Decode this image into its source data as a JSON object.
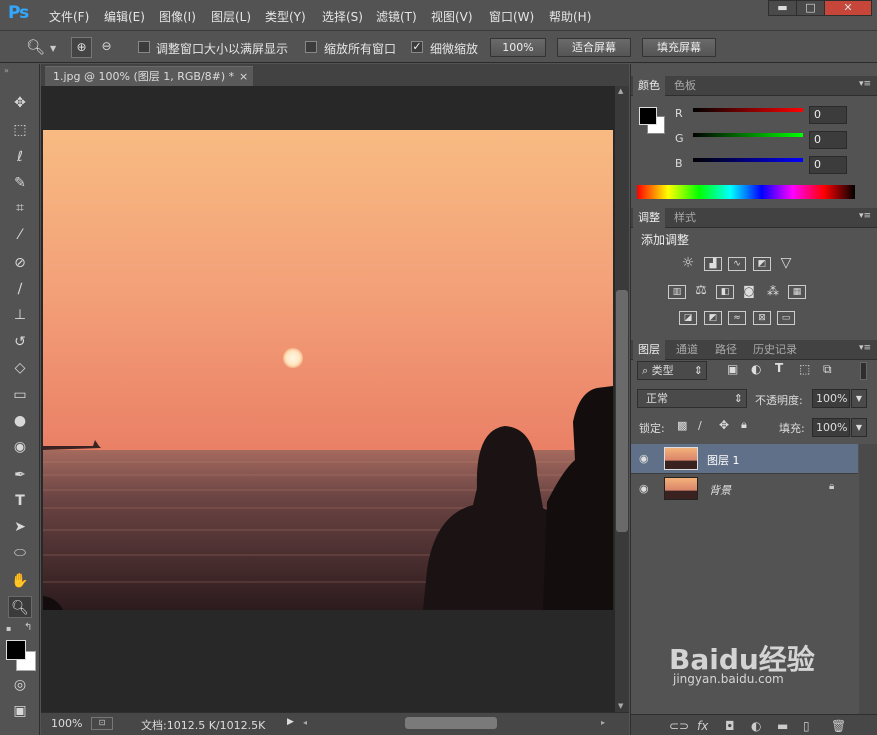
{
  "app": {
    "logo": "Ps"
  },
  "menu": [
    "文件(F)",
    "编辑(E)",
    "图像(I)",
    "图层(L)",
    "类型(Y)",
    "选择(S)",
    "滤镜(T)",
    "视图(V)",
    "窗口(W)",
    "帮助(H)"
  ],
  "window_controls": {
    "min": "▬",
    "max": "□",
    "close": "✕"
  },
  "options": {
    "resize_windows": "调整窗口大小以满屏显示",
    "zoom_all": "缩放所有窗口",
    "scrubby_zoom": "细微缩放",
    "btn_100": "100%",
    "btn_fit": "适合屏幕",
    "btn_fill": "填充屏幕"
  },
  "document": {
    "tab_title": "1.jpg @ 100% (图层 1, RGB/8#) *",
    "close": "×"
  },
  "status": {
    "zoom": "100%",
    "doc": "文档:1012.5 K/1012.5K"
  },
  "color_panel": {
    "tabs": [
      "颜色",
      "色板"
    ],
    "channels": [
      {
        "label": "R",
        "value": "0",
        "color": "#ff0000"
      },
      {
        "label": "G",
        "value": "0",
        "color": "#00ff00"
      },
      {
        "label": "B",
        "value": "0",
        "color": "#0000ff"
      }
    ]
  },
  "adjust_panel": {
    "tabs": [
      "调整",
      "样式"
    ],
    "heading": "添加调整"
  },
  "layers_panel": {
    "tabs": [
      "图层",
      "通道",
      "路径",
      "历史记录"
    ],
    "filter": "类型",
    "blend": "正常",
    "opacity_label": "不透明度:",
    "opacity": "100%",
    "lock_label": "锁定:",
    "fill_label": "填充:",
    "fill": "100%",
    "layers": [
      {
        "name": "图层 1",
        "selected": true
      },
      {
        "name": "背景",
        "selected": false
      }
    ]
  },
  "watermark": {
    "brand": "Baidu经验",
    "url": "jingyan.baidu.com"
  }
}
